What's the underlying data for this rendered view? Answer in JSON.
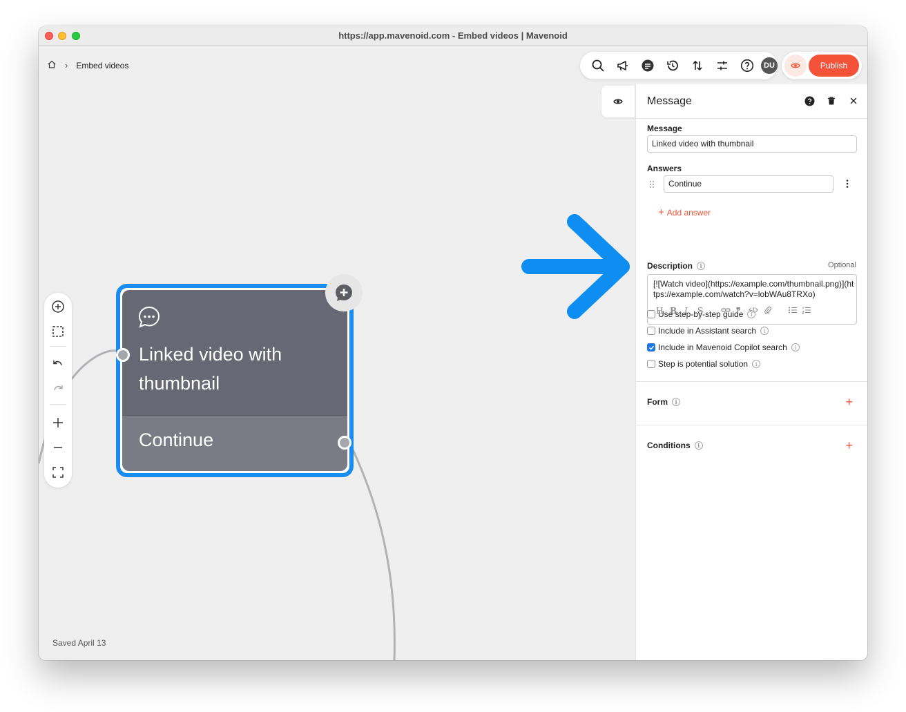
{
  "window": {
    "title": "https://app.mavenoid.com - Embed videos | Mavenoid"
  },
  "breadcrumb": {
    "current": "Embed videos"
  },
  "toolbar": {
    "icons": [
      "search-icon",
      "megaphone-icon",
      "chat-icon",
      "history-icon",
      "sort-icon",
      "sliders-icon",
      "help-icon"
    ],
    "avatar": "DU",
    "publish_label": "Publish"
  },
  "canvas": {
    "saved_text": "Saved April 13",
    "node": {
      "title": "Linked video with thumbnail",
      "answer": "Continue"
    }
  },
  "panel": {
    "title": "Message",
    "message_label": "Message",
    "message_value": "Linked video with thumbnail",
    "answers_label": "Answers",
    "answers": [
      "Continue"
    ],
    "add_answer": "Add answer",
    "description_label": "Description",
    "optional": "Optional",
    "description_value": "[![Watch video](https://example.com/thumbnail.png)](https://example.com/watch?v=lobWAu8TRXo)",
    "md_tools": [
      "H",
      "B",
      "I",
      "S",
      "link",
      "quote",
      "code",
      "attach",
      "ul",
      "ol"
    ],
    "checkboxes": [
      {
        "label": "Use step-by-step guide",
        "checked": false
      },
      {
        "label": "Include in Assistant search",
        "checked": false
      },
      {
        "label": "Include in Mavenoid Copilot search",
        "checked": true
      },
      {
        "label": "Step is potential solution",
        "checked": false
      }
    ],
    "form_label": "Form",
    "conditions_label": "Conditions"
  },
  "colors": {
    "accent": "#f4533a",
    "node_border": "#1a8cf0",
    "arrow": "#0d8ef0",
    "node_fill": "#676873"
  }
}
